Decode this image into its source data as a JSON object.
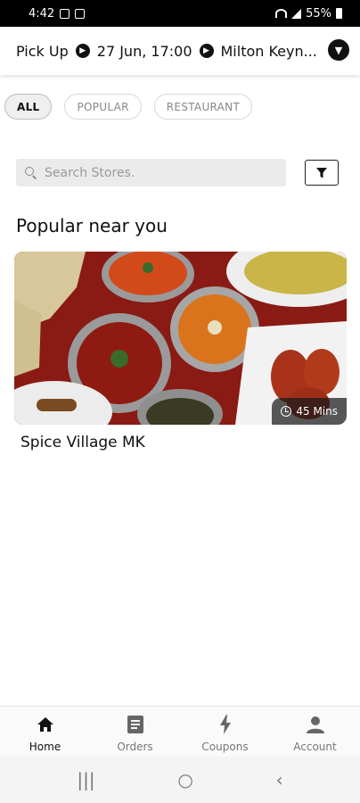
{
  "status_bar": {
    "time": "4:42",
    "battery": "55%"
  },
  "header": {
    "mode": "Pick Up",
    "datetime": "27 Jun, 17:00",
    "location": "Milton Keyn..."
  },
  "chips": [
    {
      "label": "ALL",
      "active": true
    },
    {
      "label": "POPULAR",
      "active": false
    },
    {
      "label": "RESTAURANT",
      "active": false
    }
  ],
  "search": {
    "placeholder": "Search Stores."
  },
  "section_title": "Popular near you",
  "stores": [
    {
      "name": "Spice Village MK",
      "eta": "45 Mins"
    }
  ],
  "bottom_nav": [
    {
      "label": "Home",
      "icon": "home-icon",
      "active": true
    },
    {
      "label": "Orders",
      "icon": "orders-icon",
      "active": false
    },
    {
      "label": "Coupons",
      "icon": "coupons-icon",
      "active": false
    },
    {
      "label": "Account",
      "icon": "account-icon",
      "active": false
    }
  ],
  "colors": {
    "accent": "#111111",
    "chip_active_bg": "#efefef",
    "search_bg": "#ebebeb"
  }
}
